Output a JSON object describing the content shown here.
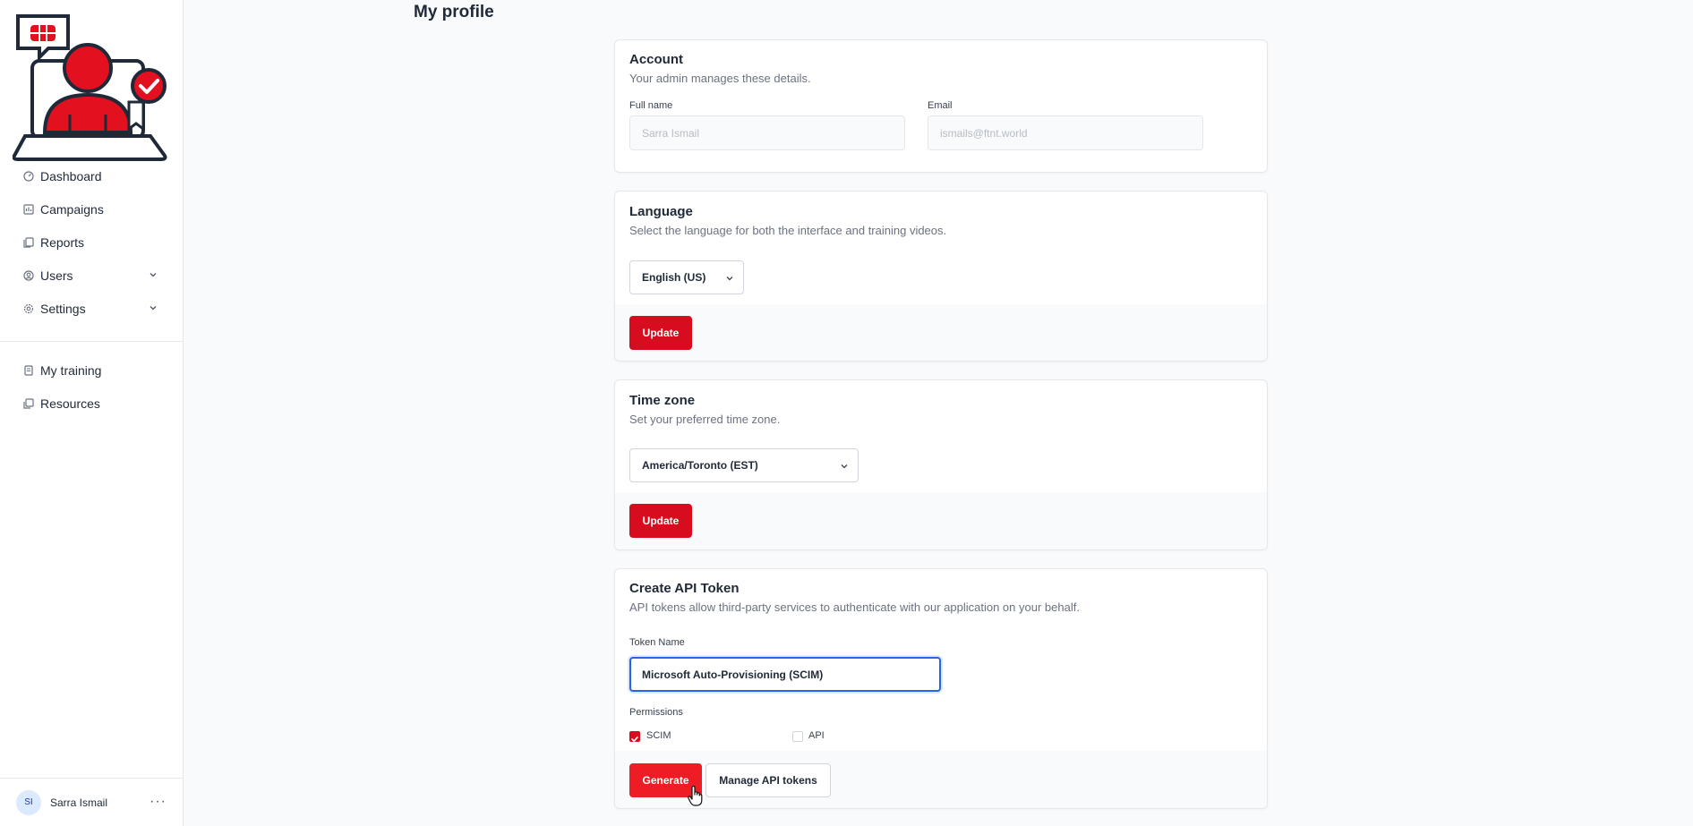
{
  "sidebar": {
    "nav": [
      {
        "label": "Dashboard",
        "icon": "dashboard-icon"
      },
      {
        "label": "Campaigns",
        "icon": "campaigns-icon"
      },
      {
        "label": "Reports",
        "icon": "reports-icon"
      },
      {
        "label": "Users",
        "icon": "users-icon"
      },
      {
        "label": "Settings",
        "icon": "settings-icon"
      }
    ],
    "nav_secondary": [
      {
        "label": "My training",
        "icon": "training-icon"
      },
      {
        "label": "Resources",
        "icon": "resources-icon"
      }
    ],
    "user": {
      "initials": "SI",
      "name": "Sarra Ismail",
      "more": "···"
    }
  },
  "page": {
    "title": "My profile"
  },
  "account": {
    "title": "Account",
    "desc": "Your admin manages these details.",
    "full_name_label": "Full name",
    "full_name_value": "Sarra Ismail",
    "email_label": "Email",
    "email_value": "ismails@ftnt.world"
  },
  "language": {
    "title": "Language",
    "desc": "Select the language for both the interface and training videos.",
    "selected": "English (US)",
    "button": "Update"
  },
  "timezone": {
    "title": "Time zone",
    "desc": "Set your preferred time zone.",
    "selected": "America/Toronto (EST)",
    "button": "Update"
  },
  "api_token": {
    "title": "Create API Token",
    "desc": "API tokens allow third-party services to authenticate with our application on your behalf.",
    "token_label": "Token Name",
    "token_value": "Microsoft Auto-Provisioning (SCIM)",
    "permissions_label": "Permissions",
    "permissions": [
      {
        "label": "SCIM",
        "checked": true
      },
      {
        "label": "API",
        "checked": false
      }
    ],
    "generate_button": "Generate",
    "manage_button": "Manage API tokens"
  },
  "colors": {
    "accent": "#d80c1f",
    "focus": "#2563eb"
  }
}
